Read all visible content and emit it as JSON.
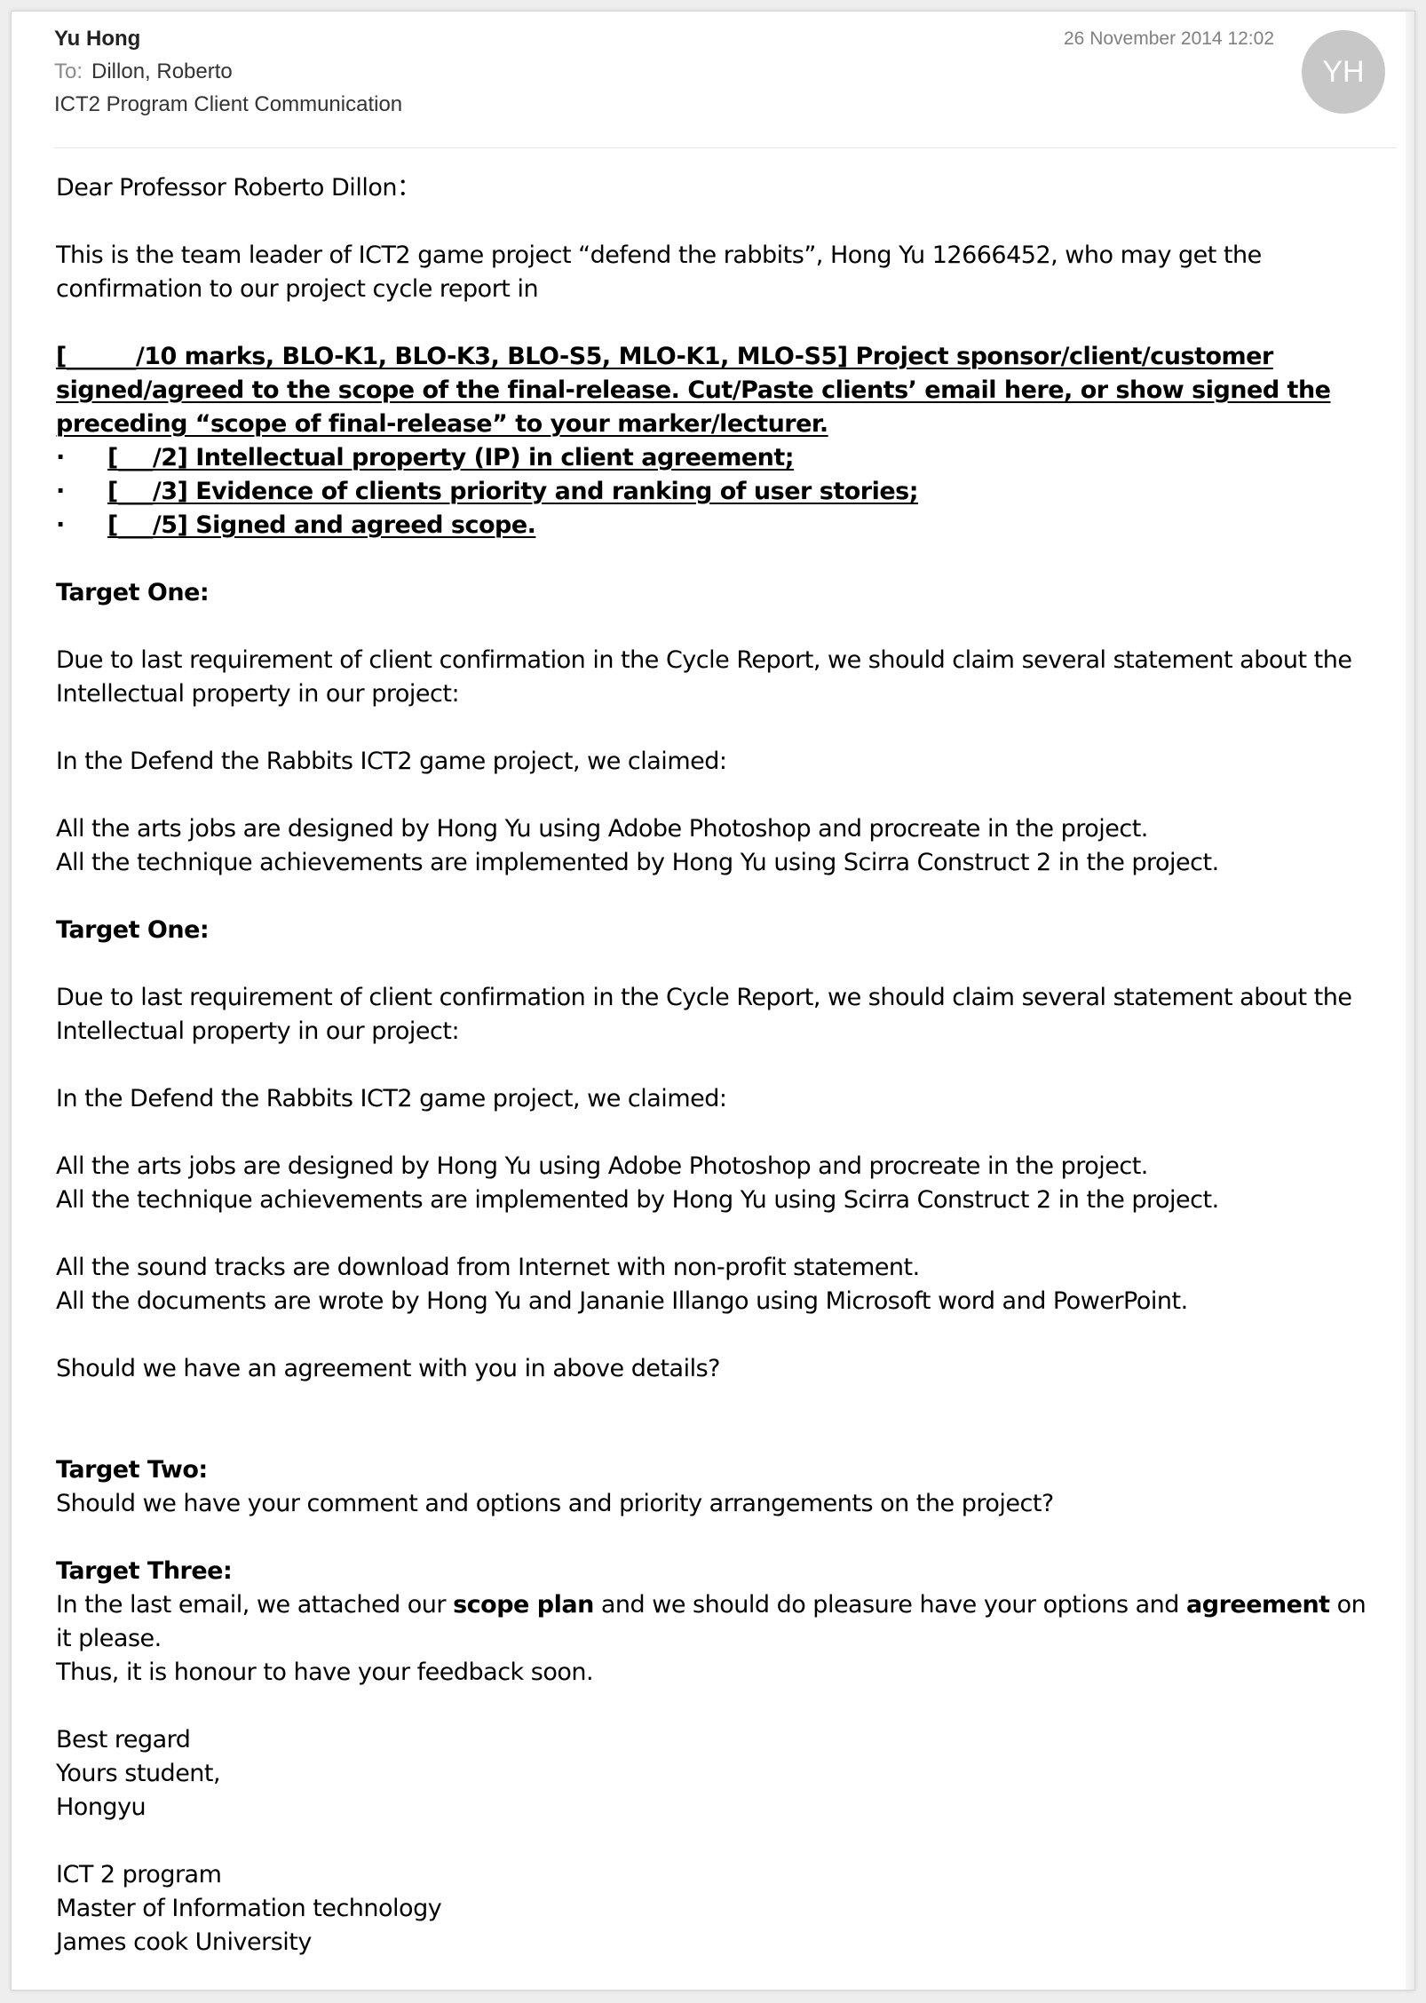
{
  "email": {
    "sender": "Yu Hong",
    "to_label": "To:",
    "to": "Dillon, Roberto",
    "subject": "ICT2 Program Client Communication",
    "date": "26 November 2014 12:02",
    "avatar_initials": "YH"
  },
  "body": {
    "greeting": "Dear Professor Roberto Dillon：",
    "intro": "This is the team leader of ICT2 game project “defend the rabbits”, Hong Yu 12666452, who may get the confirmation to our project cycle report in",
    "rubric_main": "[______/10 marks, BLO-K1, BLO-K3, BLO-S5, MLO-K1, MLO-S5] Project sponsor/client/customer signed/agreed to the scope of the final-release. Cut/Paste clients’ email here, or show signed the preceding “scope of final-release” to your marker/lecturer.",
    "rubric_bullet": "·",
    "rubric_items": [
      "[___/2] Intellectual property (IP) in client agreement;",
      "[___/3] Evidence of clients priority and ranking of user stories;",
      "[___/5] Signed and agreed scope."
    ],
    "block1_heading": "Target One:",
    "block1_para1": "Due to last requirement of client confirmation in the Cycle Report, we should claim several statement about the Intellectual property in our project:",
    "block1_para2": "In the Defend the Rabbits ICT2 game project, we claimed:",
    "block1_line1": "All the arts jobs are designed by Hong Yu using Adobe Photoshop and procreate in the project.",
    "block1_line2": "All the technique achievements are implemented by Hong Yu using Scirra Construct 2 in the project.",
    "block2_heading": "Target One:",
    "block2_para1": "Due to last requirement of client confirmation in the Cycle Report, we should claim several statement about the Intellectual property in our project:",
    "block2_para2": "In the Defend the Rabbits ICT2 game project, we claimed:",
    "block2_line1": "All the arts jobs are designed by Hong Yu using Adobe Photoshop and procreate in the project.",
    "block2_line2": "All the technique achievements are implemented by Hong Yu using Scirra Construct 2 in the project.",
    "block2_line3": "All the sound tracks are download from Internet with non-profit statement.",
    "block2_line4": "All the documents are wrote by Hong Yu and Jananie Illango using Microsoft word and PowerPoint.",
    "agreement_question": "Should we have an agreement with you in above details?",
    "target_two_heading": "Target Two:",
    "target_two_text": "Should we have your comment and options and priority arrangements on the project?",
    "target_three_heading": "Target Three:",
    "target_three_text_1": "In the last email, we attached our ",
    "target_three_bold_1": "scope plan",
    "target_three_text_2": " and we should do pleasure have your options and ",
    "target_three_bold_2": "agreement",
    "target_three_text_3": " on it please.",
    "feedback_line": "Thus, it is honour to have your feedback soon.",
    "signoff_1": "Best regard",
    "signoff_2": "Yours student,",
    "signoff_name": "Hongyu",
    "sig_1": "ICT 2 program",
    "sig_2": "Master of Information technology",
    "sig_3": "James cook University"
  }
}
